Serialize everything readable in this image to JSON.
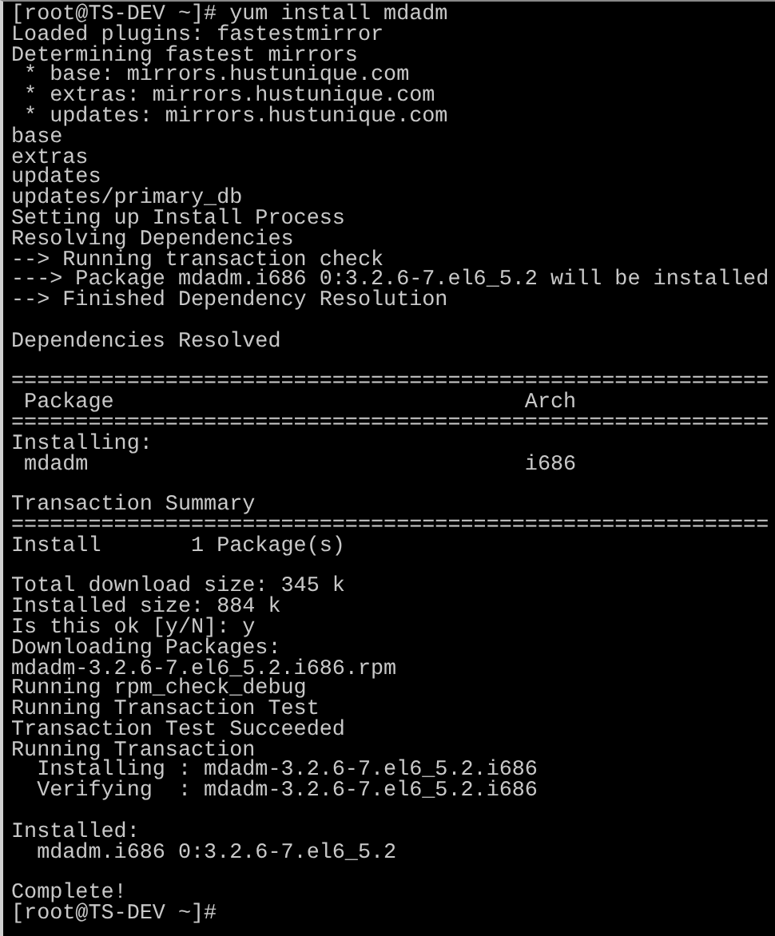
{
  "terminal": {
    "lines": [
      {
        "kind": "text",
        "text": "[root@TS-DEV ~]# yum install mdadm"
      },
      {
        "kind": "text",
        "text": "Loaded plugins: fastestmirror"
      },
      {
        "kind": "text",
        "text": "Determining fastest mirrors"
      },
      {
        "kind": "text",
        "text": " * base: mirrors.hustunique.com"
      },
      {
        "kind": "text",
        "text": " * extras: mirrors.hustunique.com"
      },
      {
        "kind": "text",
        "text": " * updates: mirrors.hustunique.com"
      },
      {
        "kind": "text",
        "text": "base"
      },
      {
        "kind": "text",
        "text": "extras"
      },
      {
        "kind": "text",
        "text": "updates"
      },
      {
        "kind": "text",
        "text": "updates/primary_db"
      },
      {
        "kind": "text",
        "text": "Setting up Install Process"
      },
      {
        "kind": "text",
        "text": "Resolving Dependencies"
      },
      {
        "kind": "text",
        "text": "--> Running transaction check"
      },
      {
        "kind": "text",
        "text": "---> Package mdadm.i686 0:3.2.6-7.el6_5.2 will be installed"
      },
      {
        "kind": "text",
        "text": "--> Finished Dependency Resolution"
      },
      {
        "kind": "blank"
      },
      {
        "kind": "text",
        "text": "Dependencies Resolved"
      },
      {
        "kind": "blank"
      },
      {
        "kind": "text",
        "text": "==========================================================="
      },
      {
        "kind": "text",
        "text": " Package                                Arch"
      },
      {
        "kind": "text",
        "text": "==========================================================="
      },
      {
        "kind": "text",
        "text": "Installing:"
      },
      {
        "kind": "text",
        "text": " mdadm                                  i686"
      },
      {
        "kind": "blank"
      },
      {
        "kind": "text",
        "text": "Transaction Summary"
      },
      {
        "kind": "text",
        "text": "==========================================================="
      },
      {
        "kind": "text",
        "text": "Install       1 Package(s)"
      },
      {
        "kind": "blank"
      },
      {
        "kind": "text",
        "text": "Total download size: 345 k"
      },
      {
        "kind": "text",
        "text": "Installed size: 884 k"
      },
      {
        "kind": "text",
        "text": "Is this ok [y/N]: y"
      },
      {
        "kind": "text",
        "text": "Downloading Packages:"
      },
      {
        "kind": "text",
        "text": "mdadm-3.2.6-7.el6_5.2.i686.rpm"
      },
      {
        "kind": "text",
        "text": "Running rpm_check_debug"
      },
      {
        "kind": "text",
        "text": "Running Transaction Test"
      },
      {
        "kind": "text",
        "text": "Transaction Test Succeeded"
      },
      {
        "kind": "text",
        "text": "Running Transaction"
      },
      {
        "kind": "text",
        "text": "  Installing : mdadm-3.2.6-7.el6_5.2.i686"
      },
      {
        "kind": "text",
        "text": "  Verifying  : mdadm-3.2.6-7.el6_5.2.i686"
      },
      {
        "kind": "blank"
      },
      {
        "kind": "text",
        "text": "Installed:"
      },
      {
        "kind": "text",
        "text": "  mdadm.i686 0:3.2.6-7.el6_5.2"
      },
      {
        "kind": "blank"
      },
      {
        "kind": "text",
        "text": "Complete!"
      },
      {
        "kind": "text",
        "text": "[root@TS-DEV ~]#"
      }
    ]
  }
}
